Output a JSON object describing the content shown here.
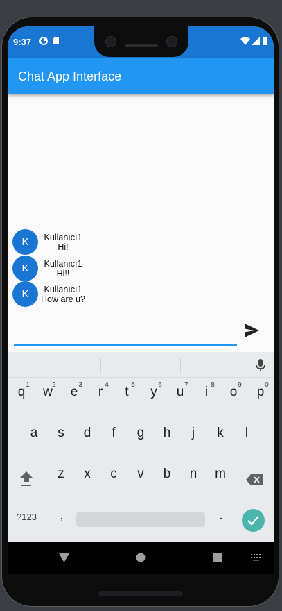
{
  "status": {
    "time": "9:37",
    "icons": [
      "data-saver-icon",
      "sd-card-icon",
      "wifi-icon",
      "signal-icon",
      "battery-icon"
    ]
  },
  "appbar": {
    "title": "Chat App Interface",
    "color": "#2196f3"
  },
  "messages": [
    {
      "avatar": "K",
      "user": "Kullanıcı1",
      "text": "Hi!"
    },
    {
      "avatar": "K",
      "user": "Kullanıcı1",
      "text": "Hi!!"
    },
    {
      "avatar": "K",
      "user": "Kullanıcı1",
      "text": "How are u?"
    }
  ],
  "composer": {
    "placeholder": "",
    "send_icon": "send-icon"
  },
  "keyboard": {
    "row1": [
      "q",
      "w",
      "e",
      "r",
      "t",
      "y",
      "u",
      "i",
      "o",
      "p"
    ],
    "row1_hints": [
      "1",
      "2",
      "3",
      "4",
      "5",
      "6",
      "7",
      "8",
      "9",
      "0"
    ],
    "row2": [
      "a",
      "s",
      "d",
      "f",
      "g",
      "h",
      "j",
      "k",
      "l"
    ],
    "row3": [
      "z",
      "x",
      "c",
      "v",
      "b",
      "n",
      "m"
    ],
    "symbols_label": "?123",
    "comma": ",",
    "period": ".",
    "mic_icon": "mic-icon",
    "enter_icon": "check-icon",
    "accent": "#4db6ac"
  },
  "navbar": {
    "icons": [
      "back-icon",
      "home-icon",
      "recents-icon",
      "keyboard-switch-icon"
    ]
  }
}
